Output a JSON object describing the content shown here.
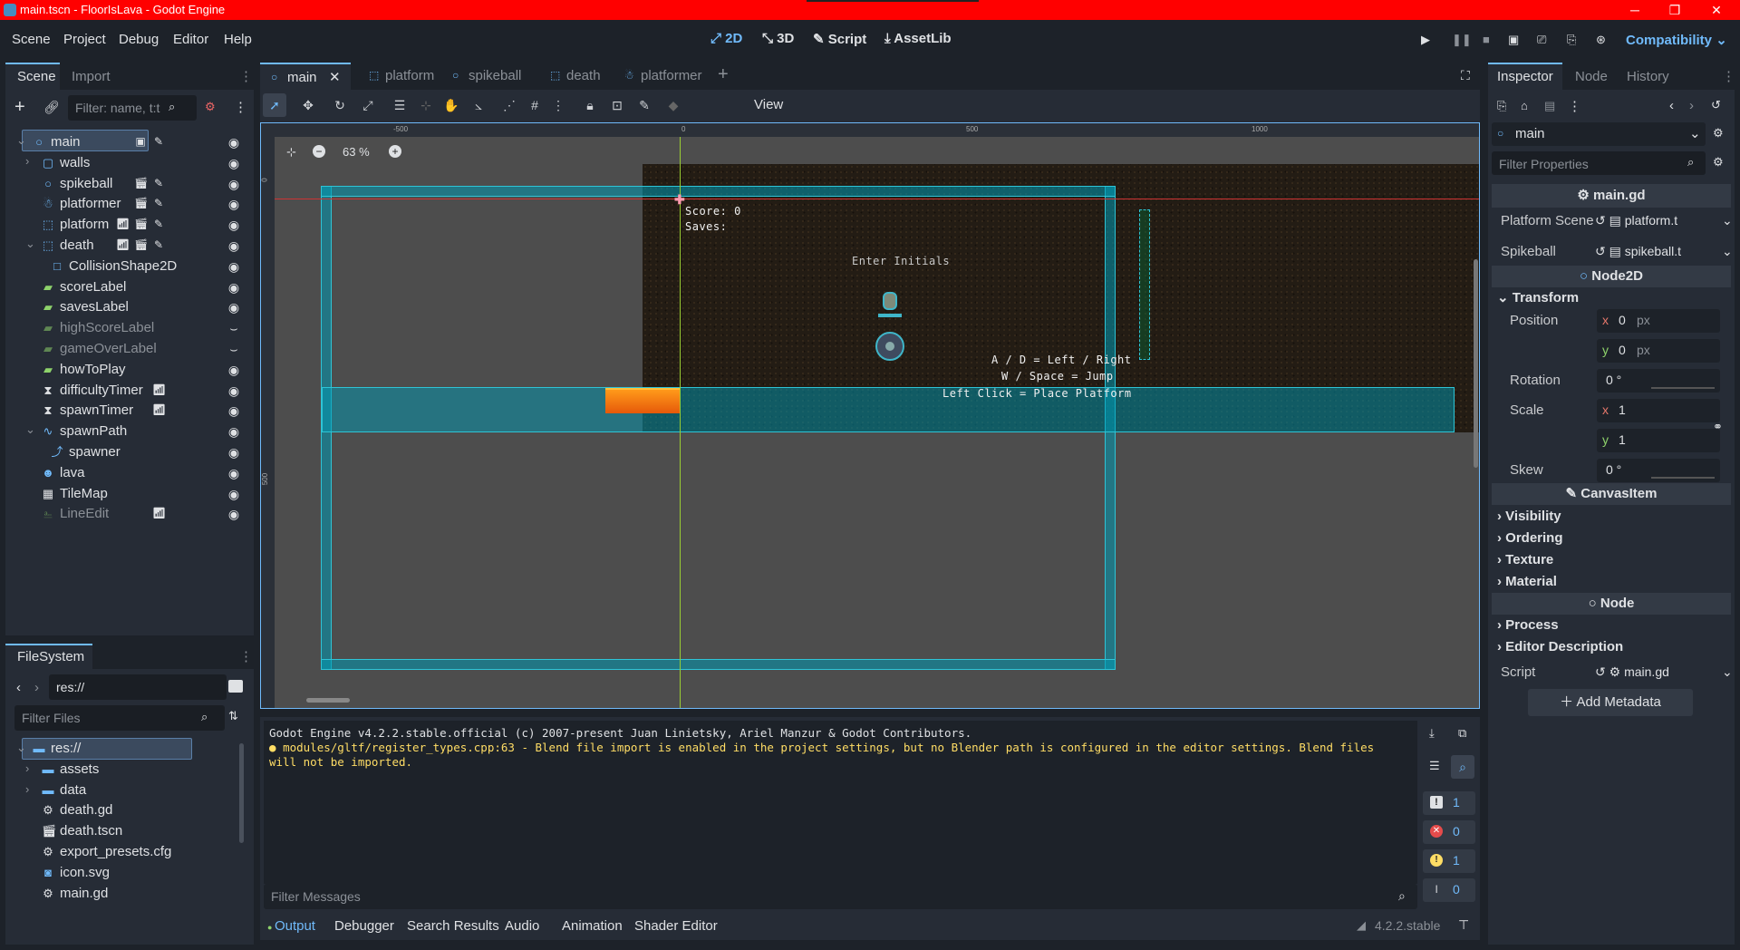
{
  "window": {
    "title": "main.tscn - FloorIsLava - Godot Engine",
    "minimize": "─",
    "maximize": "❐",
    "close": "✕"
  },
  "menu": {
    "items": [
      "Scene",
      "Project",
      "Debug",
      "Editor",
      "Help"
    ]
  },
  "workspaces": {
    "d2": "2D",
    "d3": "3D",
    "script": "Script",
    "assetlib": "AssetLib"
  },
  "renderer": "Compatibility",
  "scene_panel": {
    "tab_scene": "Scene",
    "tab_import": "Import",
    "filter_placeholder": "Filter: name, t:t",
    "nodes": [
      {
        "name": "main",
        "icon": "node2d-icon"
      },
      {
        "name": "walls",
        "icon": "staticbody-icon"
      },
      {
        "name": "spikeball",
        "icon": "node2d-icon"
      },
      {
        "name": "platformer",
        "icon": "character-icon"
      },
      {
        "name": "platform",
        "icon": "area-icon"
      },
      {
        "name": "death",
        "icon": "area-icon"
      },
      {
        "name": "CollisionShape2D",
        "icon": "collision-icon"
      },
      {
        "name": "scoreLabel",
        "icon": "label-icon"
      },
      {
        "name": "savesLabel",
        "icon": "label-icon"
      },
      {
        "name": "highScoreLabel",
        "icon": "label-icon"
      },
      {
        "name": "gameOverLabel",
        "icon": "label-icon"
      },
      {
        "name": "howToPlay",
        "icon": "label-icon"
      },
      {
        "name": "difficultyTimer",
        "icon": "timer-icon"
      },
      {
        "name": "spawnTimer",
        "icon": "timer-icon"
      },
      {
        "name": "spawnPath",
        "icon": "path-icon"
      },
      {
        "name": "spawner",
        "icon": "pathfollow-icon"
      },
      {
        "name": "lava",
        "icon": "sprite-icon"
      },
      {
        "name": "TileMap",
        "icon": "tilemap-icon"
      },
      {
        "name": "LineEdit",
        "icon": "lineedit-icon"
      }
    ]
  },
  "filesystem": {
    "tab": "FileSystem",
    "path": "res://",
    "filter_placeholder": "Filter Files",
    "items": [
      {
        "name": "res://",
        "icon": "folder-icon"
      },
      {
        "name": "assets",
        "icon": "folder-icon"
      },
      {
        "name": "data",
        "icon": "folder-icon"
      },
      {
        "name": "death.gd",
        "icon": "gear-icon"
      },
      {
        "name": "death.tscn",
        "icon": "scene-icon"
      },
      {
        "name": "export_presets.cfg",
        "icon": "gear-icon"
      },
      {
        "name": "icon.svg",
        "icon": "image-icon"
      },
      {
        "name": "main.gd",
        "icon": "gear-icon"
      }
    ]
  },
  "scene_tabs": [
    "main",
    "platform",
    "spikeball",
    "death",
    "platformer"
  ],
  "toolbar": {
    "view": "View"
  },
  "viewport": {
    "zoom": "63 %",
    "ruler": [
      "-500",
      "0",
      "500",
      "1000"
    ],
    "ruler_v": [
      "0",
      "500"
    ],
    "game_text": {
      "score": "Score: 0",
      "saves": "Saves:",
      "enter": "Enter Initials",
      "help1": "A / D = Left / Right",
      "help2": "W / Space = Jump",
      "help3": "Left Click = Place Platform"
    }
  },
  "output": {
    "line1": "Godot Engine v4.2.2.stable.official (c) 2007-present Juan Linietsky, Ariel Manzur & Godot Contributors.",
    "line2": "modules/gltf/register_types.cpp:63 - Blend file import is enabled in the project settings, but no Blender path is configured in the editor settings. Blend files will not be imported.",
    "filter_placeholder": "Filter Messages",
    "counts": {
      "messages": "1",
      "errors": "0",
      "warnings": "1",
      "editor": "0"
    }
  },
  "bottom_tabs": [
    "Output",
    "Debugger",
    "Search Results",
    "Audio",
    "Animation",
    "Shader Editor"
  ],
  "version": "4.2.2.stable",
  "inspector": {
    "tabs": [
      "Inspector",
      "Node",
      "History"
    ],
    "object": "main",
    "filter_placeholder": "Filter Properties",
    "script_header": "main.gd",
    "platform_scene_label": "Platform Scene",
    "platform_scene_value": "platform.t",
    "spikeball_label": "Spikeball",
    "spikeball_value": "spikeball.t",
    "node2d": "Node2D",
    "transform": "Transform",
    "position": "Position",
    "pos_x": "0",
    "pos_y": "0",
    "unit": "px",
    "rotation": "Rotation",
    "rotation_val": "0 °",
    "scale": "Scale",
    "scale_x": "1",
    "scale_y": "1",
    "skew": "Skew",
    "skew_val": "0 °",
    "canvasitem": "CanvasItem",
    "visibility": "Visibility",
    "ordering": "Ordering",
    "texture": "Texture",
    "material": "Material",
    "node": "Node",
    "process": "Process",
    "editor_desc": "Editor Description",
    "script_label": "Script",
    "script_value": "main.gd",
    "add_metadata": "Add Metadata"
  }
}
